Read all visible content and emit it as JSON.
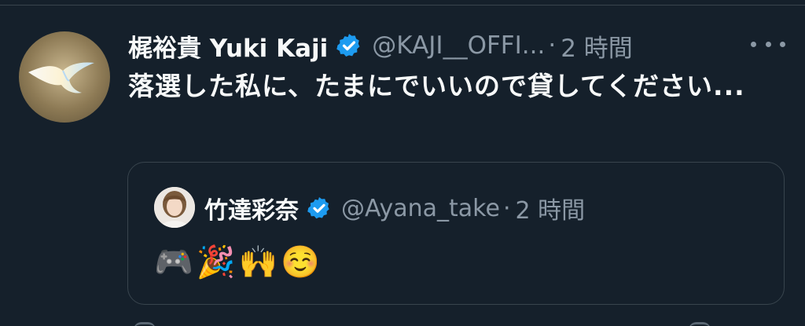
{
  "tweet": {
    "author": {
      "display_name": "梶裕貴 Yuki Kaji",
      "handle": "@KAJI__OFFI...",
      "verified": true
    },
    "separator": "·",
    "time": "2 時間",
    "text": "落選した私に、たまにでいいので貸してください...",
    "more_icon": "more-dots-icon"
  },
  "quoted_tweet": {
    "author": {
      "display_name": "竹達彩奈",
      "handle": "@Ayana_take",
      "verified": true
    },
    "separator": "·",
    "time": "2 時間",
    "text": "🎮🎉🙌☺️"
  },
  "colors": {
    "background": "#15202b",
    "primary_text": "#f7f9f9",
    "secondary_text": "#8b98a5",
    "border": "#38444d",
    "verified_blue": "#1d9bf0"
  }
}
